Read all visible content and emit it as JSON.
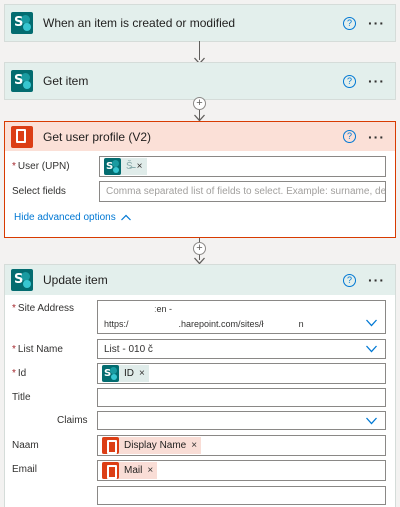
{
  "flow": {
    "step1": {
      "title": "When an item is created or modified",
      "icon": "sharepoint-icon"
    },
    "step2": {
      "title": "Get item",
      "icon": "sharepoint-icon"
    },
    "step3": {
      "title": "Get user profile (V2)",
      "icon": "office365-icon",
      "user_label": "User (UPN)",
      "user_token": "Š̶̶̶̶̶̶̶̶",
      "select_fields_label": "Select fields",
      "select_fields_placeholder": "Comma separated list of fields to select. Example: surname, department, jobTitl",
      "advanced_link": "Hide advanced options"
    },
    "step4": {
      "title": "Update item",
      "icon": "sharepoint-icon",
      "site_address_label": "Site Address",
      "site_address_line1": "ːen -",
      "site_address_line2": "https:/                    .harepoint.com/sites/ł              n",
      "list_name_label": "List Name",
      "list_name_value": "List - 010 č",
      "id_label": "Id",
      "id_token": "ID",
      "title_label": "Title",
      "claims_label": "Claims",
      "naam_label": "Naam",
      "naam_token": "Display Name",
      "email_label": "Email",
      "email_token": "Mail"
    }
  },
  "ui": {
    "help_glyph": "?",
    "more_glyph": "···",
    "remove_glyph": "×",
    "plus_glyph": "+",
    "required_mark": "*"
  },
  "colors": {
    "sharepoint_teal": "#036c70",
    "office_red": "#dc3e15",
    "selected_border": "#d83b01",
    "selected_header": "#fbe0d7",
    "link_blue": "#0078d4"
  }
}
